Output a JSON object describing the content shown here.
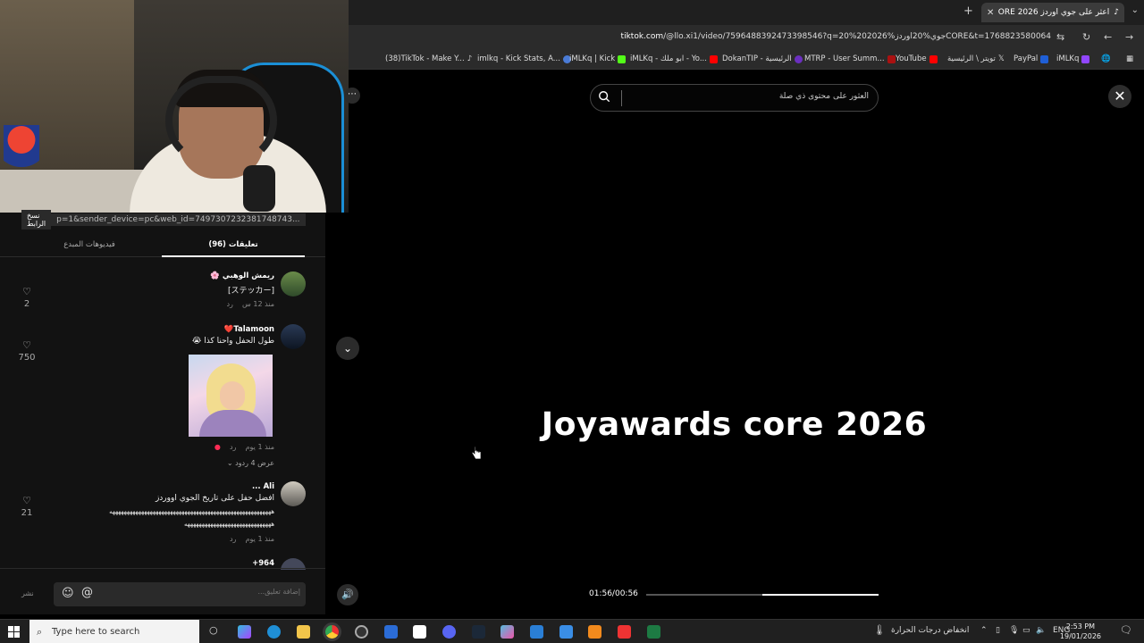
{
  "browser": {
    "tab_title": "اعثر على جوي اوردز 2026 CORE",
    "new_tab": "+",
    "url_domain": "tiktok.com",
    "url_rest": "/@llo.xi1/video/7596488392473398546?q=جوي%20اوردز%202026%20CORE&t=1768823580064",
    "bookmarks": [
      "(38)TikTok - Make Y...",
      "imlkq - Kick Stats, A...",
      "iMLKq | Kick",
      "iMLKq - ابو ملك - Yo...",
      "DokanTIP - الرئيسية",
      "MTRP - User Summ...",
      "YouTube",
      "تويتر \\ الرئيسية",
      "PayPal",
      "iMLKq"
    ]
  },
  "panel": {
    "copy_link_label": "نسخ الرابط",
    "link_text": "p=1&sender_device=pc&web_id=7497307232381748743...",
    "tab_comments": "تعليقات (96)",
    "tab_creator_videos": "فيديوهات المبدع"
  },
  "comments": [
    {
      "name": "ريمش الوهبي 🌸",
      "text": "[ステッカー]",
      "time": "منذ 12 س",
      "reply": "رد",
      "likes": "2"
    },
    {
      "name": "Talamoon❤️",
      "text": "طول الحفل واحنا كذا 😭",
      "time": "منذ 1 يوم",
      "reply": "رد",
      "likes": "750",
      "view_replies": "عرض 4 ردود"
    },
    {
      "name": "Ali ...",
      "text": "افضل حفل على تاريخ الجوي اووردز",
      "text2": "ههههههههههههههههههههههههههههههههههههههههههههههههههههههههه",
      "text3": "ههههههههههههههههههههههههههههههه",
      "time": "منذ 1 يوم",
      "reply": "رد",
      "likes": "21"
    },
    {
      "name": "964+"
    }
  ],
  "composer": {
    "placeholder": "إضافة تعليق...",
    "post": "نشر"
  },
  "video": {
    "search_placeholder": "العثور على محتوى ذي صلة",
    "title": "Joyawards core 2026",
    "timestamp": "01:56/00:56",
    "progress": 0.5
  },
  "taskbar": {
    "search_placeholder": "Type here to search",
    "weather": "انخفاض درجات الحرارة",
    "lang": "ENG",
    "time": "2:53 PM",
    "date": "19/01/2026"
  },
  "colors": {
    "chair_accent": "#1b8fd6",
    "tiktok_pink": "#fe2c55",
    "youtube_red": "#ff0000"
  }
}
